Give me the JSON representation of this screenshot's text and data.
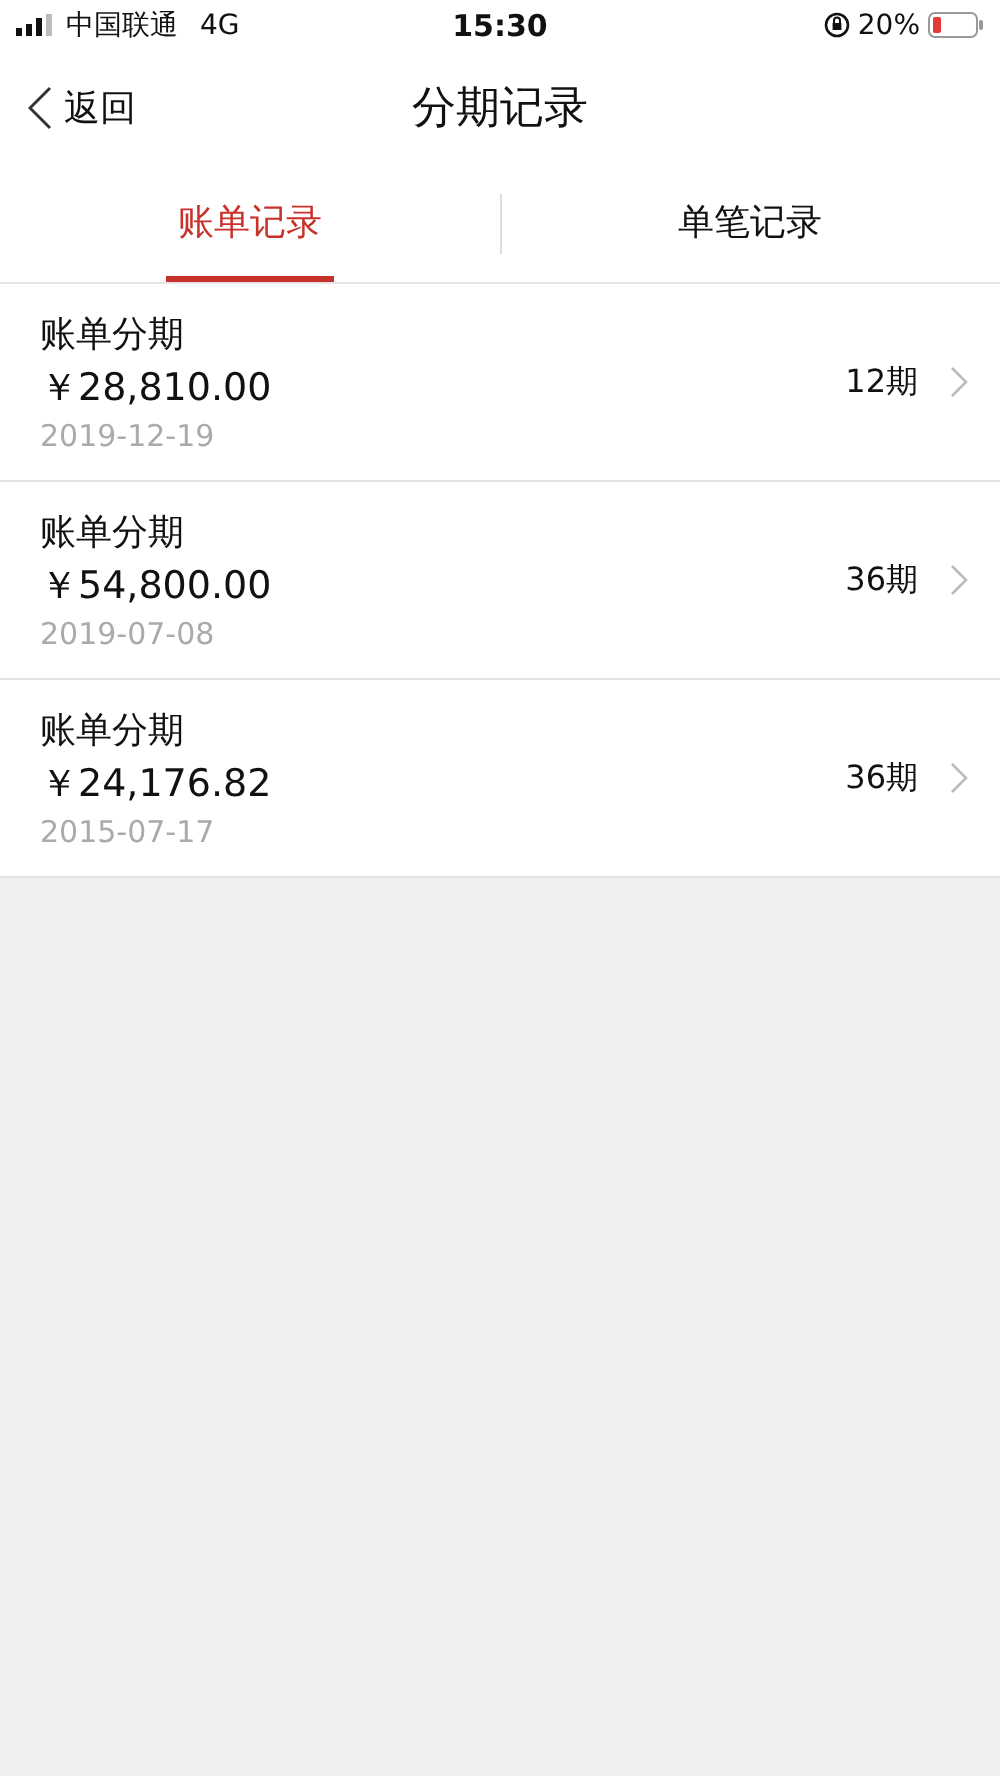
{
  "status_bar": {
    "carrier": "中国联通",
    "network": "4G",
    "time": "15:30",
    "battery": "20%"
  },
  "nav": {
    "back": "返回",
    "title": "分期记录"
  },
  "tabs": [
    {
      "label": "账单记录",
      "selected": true
    },
    {
      "label": "单笔记录",
      "selected": false
    }
  ],
  "records": [
    {
      "title": "账单分期",
      "amount": "￥28,810.00",
      "date": "2019-12-19",
      "periods": "12期"
    },
    {
      "title": "账单分期",
      "amount": "￥54,800.00",
      "date": "2019-07-08",
      "periods": "36期"
    },
    {
      "title": "账单分期",
      "amount": "￥24,176.82",
      "date": "2015-07-17",
      "periods": "36期"
    }
  ]
}
